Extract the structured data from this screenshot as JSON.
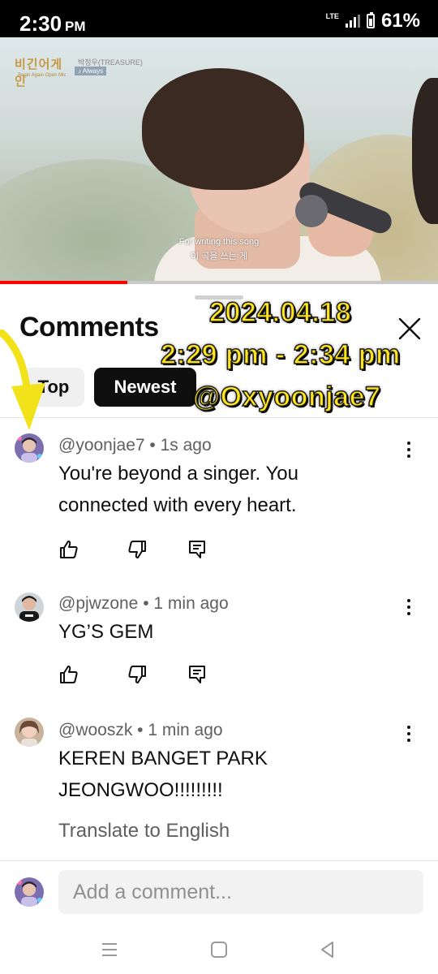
{
  "status": {
    "time": "2:30",
    "ampm": "PM",
    "network": "LTE",
    "battery": "61%"
  },
  "video": {
    "show_logo": "비긴어게인",
    "show_logo_sub": "Begin Again Open Mic",
    "artist": "박정우(TREASURE)",
    "song": "♪ Always",
    "subtitle_en": "For writing this song",
    "subtitle_ko": "이 곡을 쓰는 게",
    "progress_pct": 29
  },
  "sheet": {
    "title": "Comments",
    "chips": [
      {
        "label": "Top",
        "selected": false
      },
      {
        "label": "Newest",
        "selected": true
      }
    ]
  },
  "overlay": {
    "date": "2024.04.18",
    "time_range": "2:29 pm - 2:34 pm",
    "handle": "@Oxyoonjae7"
  },
  "comments": [
    {
      "author": "@yoonjae7",
      "age": "1s ago",
      "lines": [
        "You're beyond a singer. You",
        "connected with every heart."
      ]
    },
    {
      "author": "@pjwzone",
      "age": "1 min ago",
      "lines": [
        "YG’S GEM"
      ]
    },
    {
      "author": "@wooszk",
      "age": "1 min ago",
      "lines": [
        "KEREN BANGET PARK",
        "JEONGWOO!!!!!!!!!"
      ],
      "translate": "Translate to English"
    }
  ],
  "composer": {
    "placeholder": "Add a comment..."
  },
  "colors": {
    "accent": "#ff0000",
    "overlay_text": "#ffe51a",
    "arrow": "#f2e21a"
  }
}
